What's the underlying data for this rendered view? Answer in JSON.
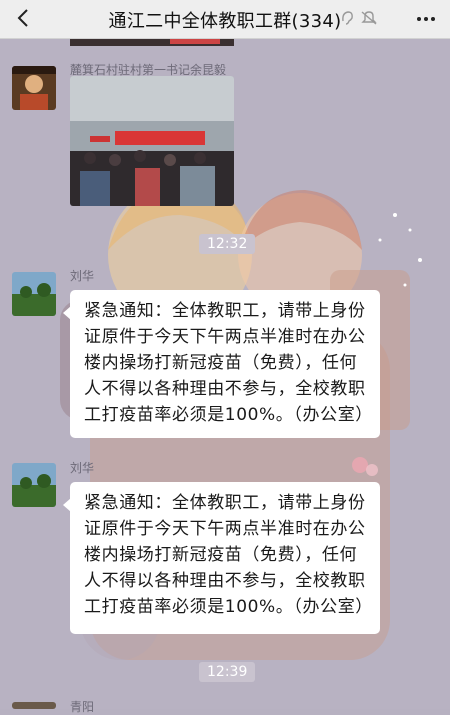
{
  "header": {
    "title": "通江二中全体教职工群(334)"
  },
  "messages": [
    {
      "sender": "麓箕石村驻村第一书记余昆毅",
      "type": "image"
    },
    {
      "time": "12:32"
    },
    {
      "sender": "刘华",
      "text": "紧急通知：全体教职工，请带上身份证原件于今天下午两点半准时在办公楼内操场打新冠疫苗（免费），任何人不得以各种理由不参与，全校教职工打疫苗率必须是100%。（办公室）"
    },
    {
      "sender": "刘华",
      "text": "紧急通知：全体教职工，请带上身份证原件于今天下午两点半准时在办公楼内操场打新冠疫苗（免费），任何人不得以各种理由不参与，全校教职工打疫苗率必须是100%。（办公室）"
    },
    {
      "time": "12:39"
    },
    {
      "sender": "青阳"
    }
  ],
  "icons": {
    "back": "chevron-left-icon",
    "ear": "ear-icon",
    "mute": "bell-muted-icon",
    "more": "more-icon"
  },
  "colors": {
    "header_bg": "#eeeeee",
    "chat_bg": "#b7b1c1",
    "bubble_bg": "#ffffff",
    "time_pill": "#c9c3cf"
  }
}
